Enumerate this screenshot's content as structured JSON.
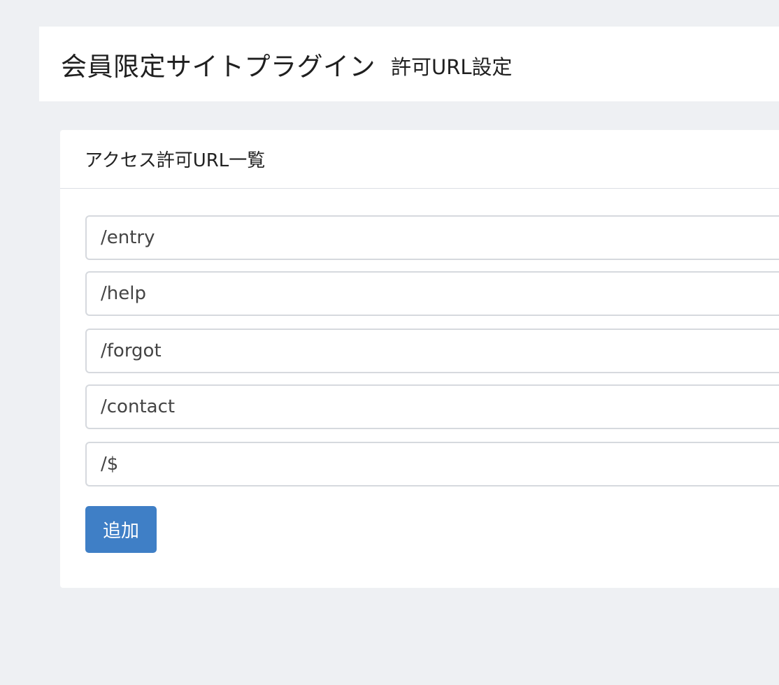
{
  "header": {
    "title": "会員限定サイトプラグイン",
    "subtitle": "許可URL設定"
  },
  "card": {
    "title": "アクセス許可URL一覧",
    "urls": [
      {
        "value": "/entry"
      },
      {
        "value": "/help"
      },
      {
        "value": "/forgot"
      },
      {
        "value": "/contact"
      },
      {
        "value": "/$"
      }
    ],
    "add_button_label": "追加"
  },
  "colors": {
    "background": "#eef0f3",
    "panel": "#ffffff",
    "button": "#3f7fc6",
    "input_border": "#d6d9de"
  }
}
